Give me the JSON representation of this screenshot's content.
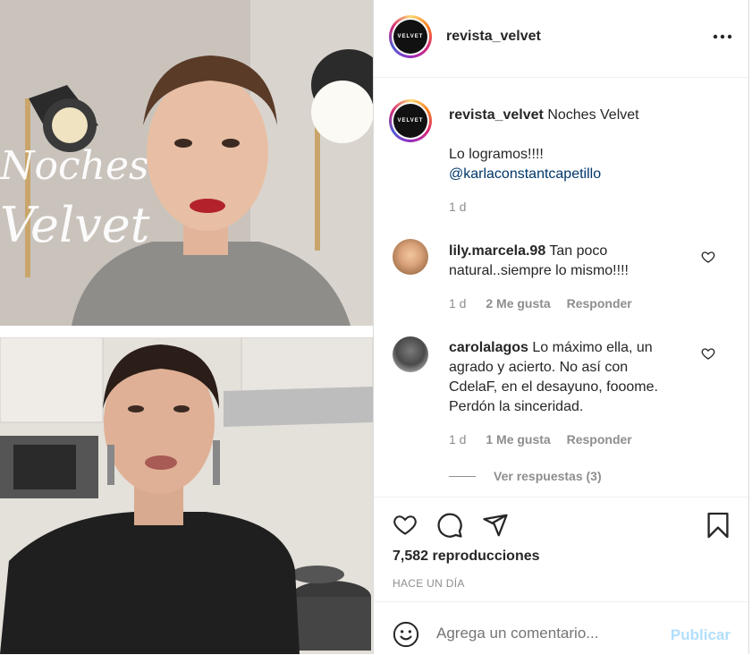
{
  "post": {
    "username": "revista_velvet",
    "avatar_text": "VELVET",
    "more_label": "Más opciones"
  },
  "caption": {
    "username": "revista_velvet",
    "title": "Noches Velvet",
    "text": "Lo logramos!!!!",
    "mention": "@karlaconstantcapetillo",
    "age": "1 d"
  },
  "comments": [
    {
      "username": "lily.marcela.98",
      "line1": "Tan poco",
      "line2": "natural..siempre lo mismo!!!!",
      "age": "1 d",
      "likes": "2 Me gusta",
      "reply": "Responder"
    },
    {
      "username": "carolalagos",
      "line1": "Lo máximo ella, un",
      "line2": "agrado y acierto. No así con",
      "line3": "CdelaF, en el desayuno, fooome.",
      "line4": "Perdón la sinceridad.",
      "age": "1 d",
      "likes": "1 Me gusta",
      "reply": "Responder",
      "view_replies": "Ver respuestas (3)"
    }
  ],
  "stats": {
    "views": "7,582 reproducciones",
    "time": "HACE UN DÍA"
  },
  "comment_box": {
    "placeholder": "Agrega un comentario...",
    "publish": "Publicar"
  },
  "video": {
    "neon_line1": "Noches",
    "neon_line2": "Velvet"
  },
  "colors": {
    "link": "#00376b",
    "muted": "#8e8e8e",
    "publish_disabled": "#b2dffc"
  }
}
